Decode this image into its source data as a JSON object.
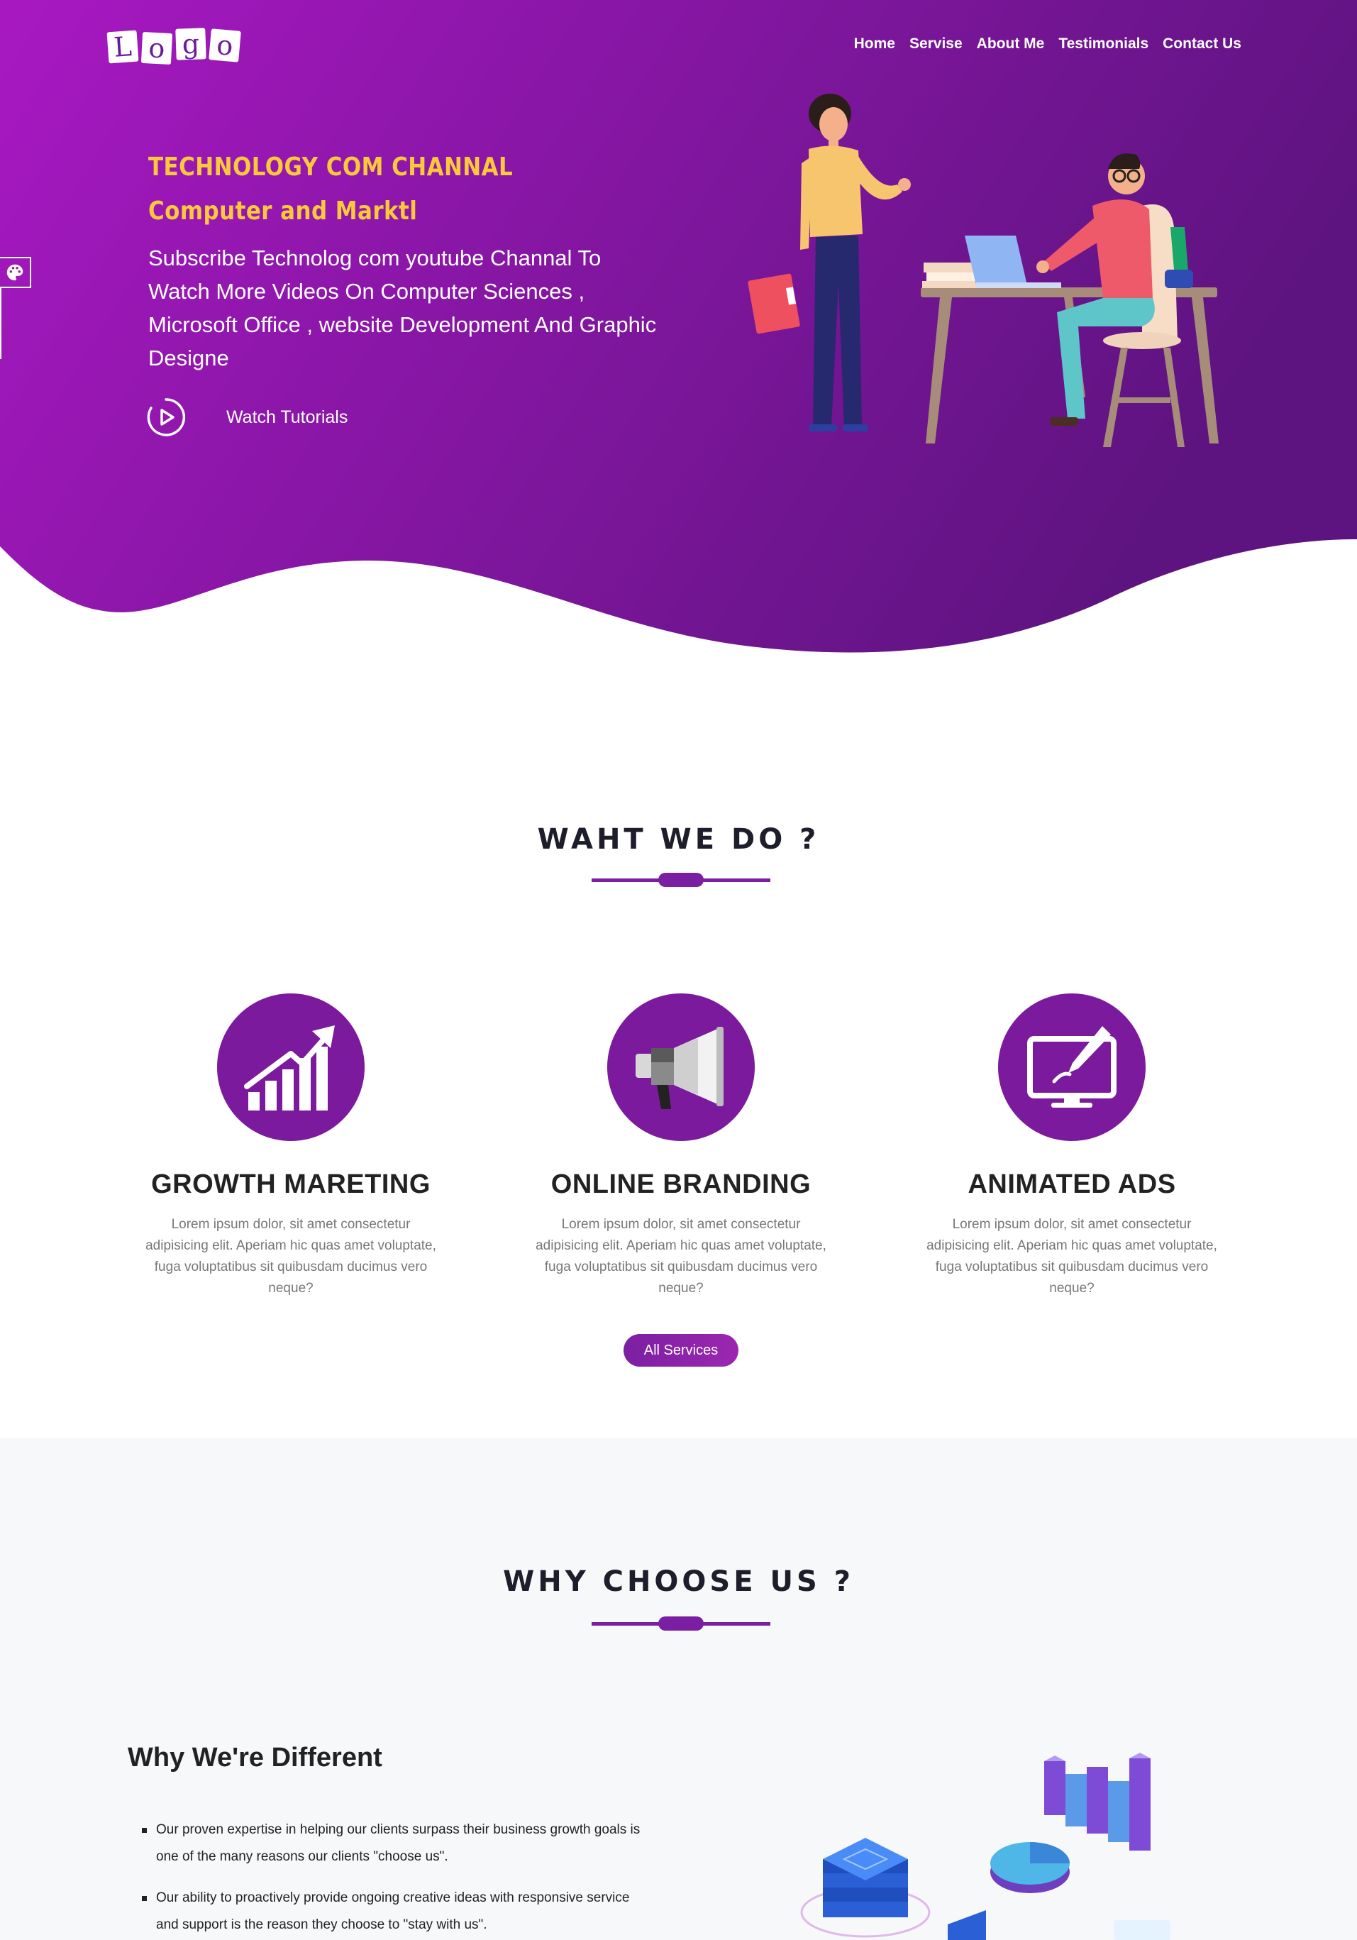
{
  "nav": {
    "logo_letters": [
      "L",
      "o",
      "g",
      "o"
    ],
    "items": [
      {
        "label": "Home"
      },
      {
        "label": "Servise"
      },
      {
        "label": "About Me"
      },
      {
        "label": "Testimonials"
      },
      {
        "label": "Contact Us"
      }
    ]
  },
  "hero": {
    "title_line1": "TECHNOLOGY COM CHANNAL",
    "title_line2": "Computer and Marktl",
    "description": "Subscribe Technolog com youtube Channal To Watch More Videos On Computer Sciences , Microsoft Office , website Development And Graphic Designe",
    "watch_label": "Watch Tutorials",
    "colors": {
      "gradient_start": "#a818c2",
      "gradient_end": "#5e1480",
      "title": "#f9c93a"
    }
  },
  "what_we_do": {
    "title": "WAHT WE DO ?",
    "services": [
      {
        "icon": "growth-chart-icon",
        "title": "GROWTH MARETING",
        "text": "Lorem ipsum dolor, sit amet consectetur adipisicing elit. Aperiam hic quas amet voluptate, fuga voluptatibus sit quibusdam ducimus vero neque?"
      },
      {
        "icon": "megaphone-icon",
        "title": "ONLINE BRANDING",
        "text": "Lorem ipsum dolor, sit amet consectetur adipisicing elit. Aperiam hic quas amet voluptate, fuga voluptatibus sit quibusdam ducimus vero neque?"
      },
      {
        "icon": "monitor-pen-icon",
        "title": "ANIMATED ADS",
        "text": "Lorem ipsum dolor, sit amet consectetur adipisicing elit. Aperiam hic quas amet voluptate, fuga voluptatibus sit quibusdam ducimus vero neque?"
      }
    ],
    "button_label": "All Services",
    "accent": "#7b1fa2"
  },
  "why_choose": {
    "title": "WHY CHOOSE US ?",
    "heading": "Why We're Different",
    "points": [
      "Our proven expertise in helping our clients surpass their business growth goals is one of the many reasons our clients \"choose us\".",
      "Our ability to proactively provide ongoing creative ideas with responsive service and support is the reason they choose to \"stay with us\"."
    ]
  }
}
